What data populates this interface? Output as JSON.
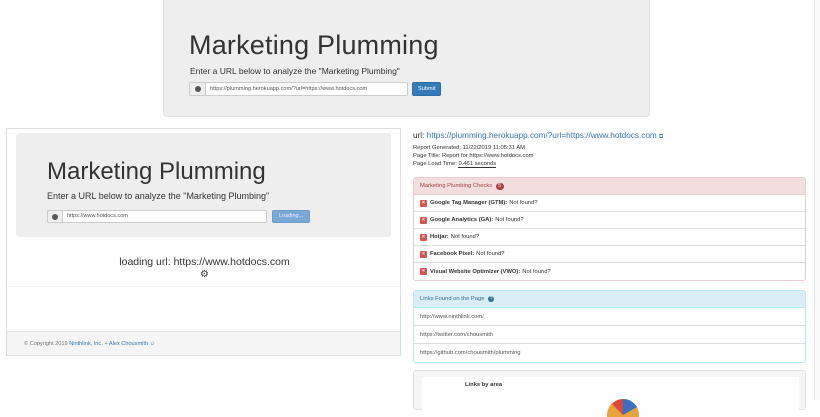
{
  "top": {
    "title": "Marketing Plumming",
    "subtitle": "Enter a URL below to analyze the \"Marketing Plumbing\"",
    "url_value": "https://plumming.herokuapp.com/?url=https://www.hotdocs.com",
    "submit_label": "Submit"
  },
  "frame": {
    "title": "Marketing Plumming",
    "subtitle": "Enter a URL below to analyze the \"Marketing Plumbing\"",
    "url_value": "https://www.hotdocs.com",
    "loading_button": "Loading...",
    "loading_text": "loading url: https://www.hotdocs.com",
    "footer": {
      "copyright": "© Copyright 2019",
      "company": "Ninthlink, Inc.",
      "separator": "+",
      "author": "Alex Chousmith"
    }
  },
  "report": {
    "url_label": "url:",
    "url": "https://plumming.herokuapp.com/?url=https://www.hotdocs.com",
    "generated": "Report Generated: 11/22/2019 11:05:31 AM",
    "page_title": "Page Title: Report for https://www.hotdocs.com",
    "load_time_label": "Page Load Time:",
    "load_time_value": "0.461 seconds",
    "checks_header": "Marketing Plumbing Checks",
    "checks_count": "5",
    "checks": [
      {
        "name": "Google Tag Manager (GTM):",
        "status": "Not found?"
      },
      {
        "name": "Google Analytics (GA):",
        "status": "Not found?"
      },
      {
        "name": "Hotjar:",
        "status": "Not found?"
      },
      {
        "name": "Facebook Pixel:",
        "status": "Not found?"
      },
      {
        "name": "Visual Website Optimizer (VWO):",
        "status": "Not found?"
      }
    ],
    "links_header": "Links Found on the Page",
    "links": [
      "http://www.ninthlink.com/",
      "https://twitter.com/chousmith",
      "https://github.com/chousmith/plumming"
    ],
    "chart_title": "Links by area"
  },
  "colors": {
    "primary": "#337ab7",
    "danger": "#a94442",
    "danger_bg": "#f2dede",
    "info_bg": "#d9edf7",
    "jumbotron": "#eeeeee"
  }
}
